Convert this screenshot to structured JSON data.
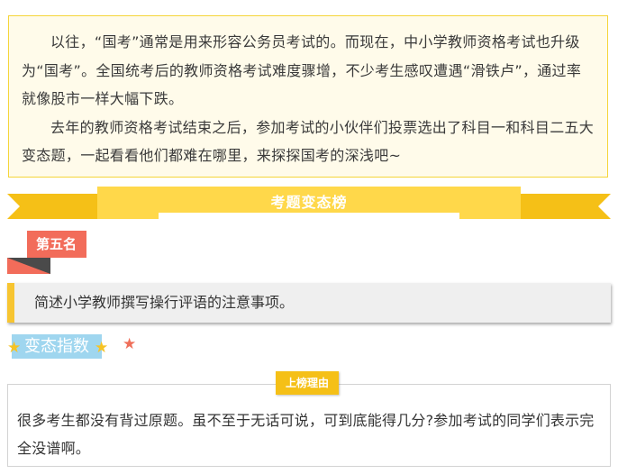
{
  "intro": {
    "paragraph_1": "以往，“国考”通常是用来形容公务员考试的。而现在，中小学教师资格考试也升级为“国考”。全国统考后的教师资格考试难度骤增，不少考生感叹遭遇“滑铁卢”，通过率就像股市一样大幅下跌。",
    "paragraph_2": "去年的教师资格考试结束之后，参加考试的小伙伴们投票选出了科目一和科目二五大变态题，一起看看他们都难在哪里，来探探国考的深浅吧~"
  },
  "ribbon": {
    "title": "考题变态榜"
  },
  "rank": {
    "label": "第五名"
  },
  "question": {
    "text": "简述小学教师撰写操行评语的注意事项。"
  },
  "difficulty": {
    "label": "变态指数",
    "rating": 1,
    "rating_symbol": "★"
  },
  "reason": {
    "tag": "上榜理由",
    "text": "很多考生都没有背过原题。虽不至于无话可说，可到底能得几分?参加考试的同学们表示完全没谱啊。"
  },
  "colors": {
    "accent_yellow": "#f5c017",
    "ribbon_light": "#ffd84a",
    "rank_red": "#f26c5a",
    "difficulty_blue": "#9fd6ef",
    "intro_border": "#f5d53a"
  }
}
